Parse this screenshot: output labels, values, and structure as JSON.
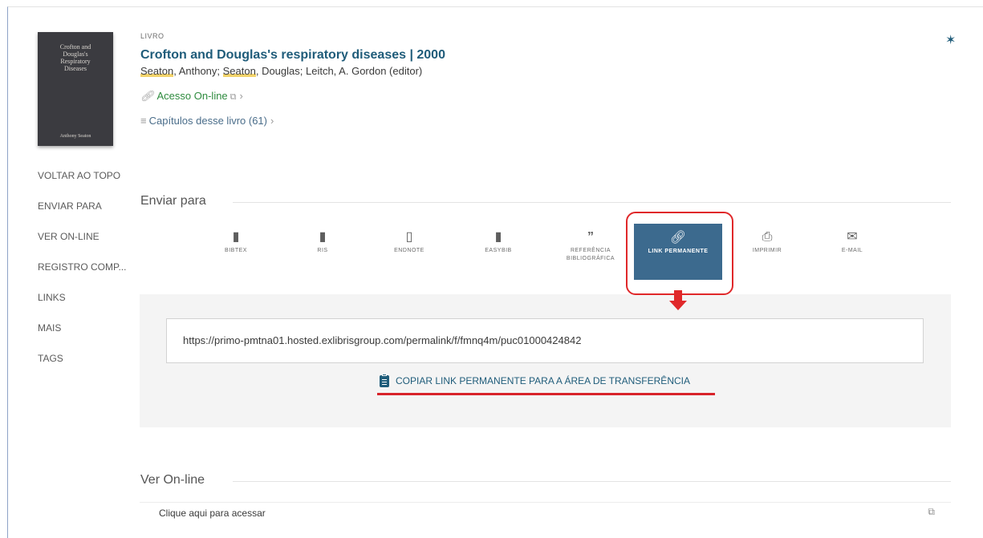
{
  "record": {
    "type_label": "LIVRO",
    "title": "Crofton and Douglas's respiratory diseases | 2000",
    "authors": [
      {
        "highlight": "Seaton",
        "rest": ", Anthony; "
      },
      {
        "highlight": "Seaton",
        "rest": ", Douglas; Leitch, A. Gordon (editor)"
      }
    ],
    "access_label": "Acesso On-line",
    "chapters_label": "Capítulos desse livro (61)",
    "cover": {
      "title_lines": [
        "Crofton and",
        "Douglas's",
        "Respiratory",
        "Diseases"
      ],
      "author": "Anthony Seaton"
    }
  },
  "side_nav": [
    "VOLTAR AO TOPO",
    "ENVIAR PARA",
    "VER ON-LINE",
    "REGISTRO COMP...",
    "LINKS",
    "MAIS",
    "TAGS"
  ],
  "send_section": {
    "title": "Enviar para",
    "buttons": [
      {
        "label": "BIBTEX",
        "icon": "bibtex-file-icon"
      },
      {
        "label": "RIS",
        "icon": "ris-file-icon"
      },
      {
        "label": "ENDNOTE",
        "icon": "endnote-file-icon"
      },
      {
        "label": "EASYBIB",
        "icon": "easybib-file-icon"
      },
      {
        "label": "REFERÊNCIA BIBLIOGRÁFICA",
        "icon": "quote-icon"
      },
      {
        "label": "LINK PERMANENTE",
        "icon": "link-icon"
      },
      {
        "label": "IMPRIMIR",
        "icon": "print-icon"
      },
      {
        "label": "E-MAIL",
        "icon": "email-icon"
      }
    ]
  },
  "permalink": {
    "url": "https://primo-pmtna01.hosted.exlibrisgroup.com/permalink/f/fmnq4m/puc01000424842",
    "copy_label": "COPIAR LINK PERMANENTE PARA A ÁREA DE TRANSFERÊNCIA"
  },
  "online_section": {
    "title": "Ver On-line",
    "link_label": "Clique aqui para acessar"
  },
  "colors": {
    "accent": "#3c6a8e",
    "title": "#1f5c7a",
    "annotation": "#e0282a",
    "access": "#2e8b3e"
  }
}
